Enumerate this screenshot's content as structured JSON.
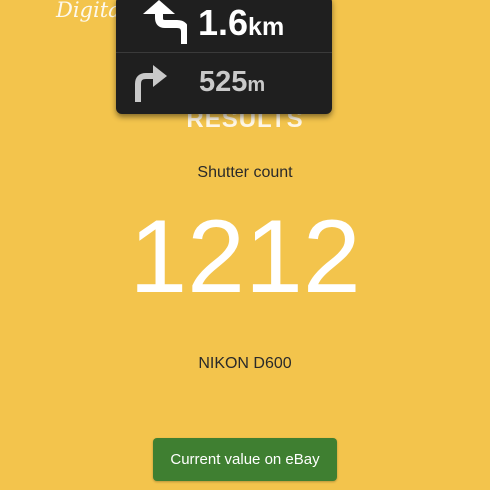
{
  "header": {
    "brand_text": "Digita",
    "results_heading": "RESULTS"
  },
  "navigation_overlay": {
    "primary": {
      "icon": "turn-left-arrow-icon",
      "distance": "1.6",
      "unit": "km"
    },
    "secondary": {
      "icon": "turn-right-arrow-icon",
      "distance": "525",
      "unit": "m"
    }
  },
  "result": {
    "label": "Shutter count",
    "count": "1212",
    "camera_model": "NIKON D600"
  },
  "actions": {
    "ebay_button_label": "Current value on eBay"
  },
  "colors": {
    "background": "#f3c44c",
    "nav_card": "#1f1f1f",
    "button": "#3f7f31",
    "count_text": "#ffffff"
  }
}
